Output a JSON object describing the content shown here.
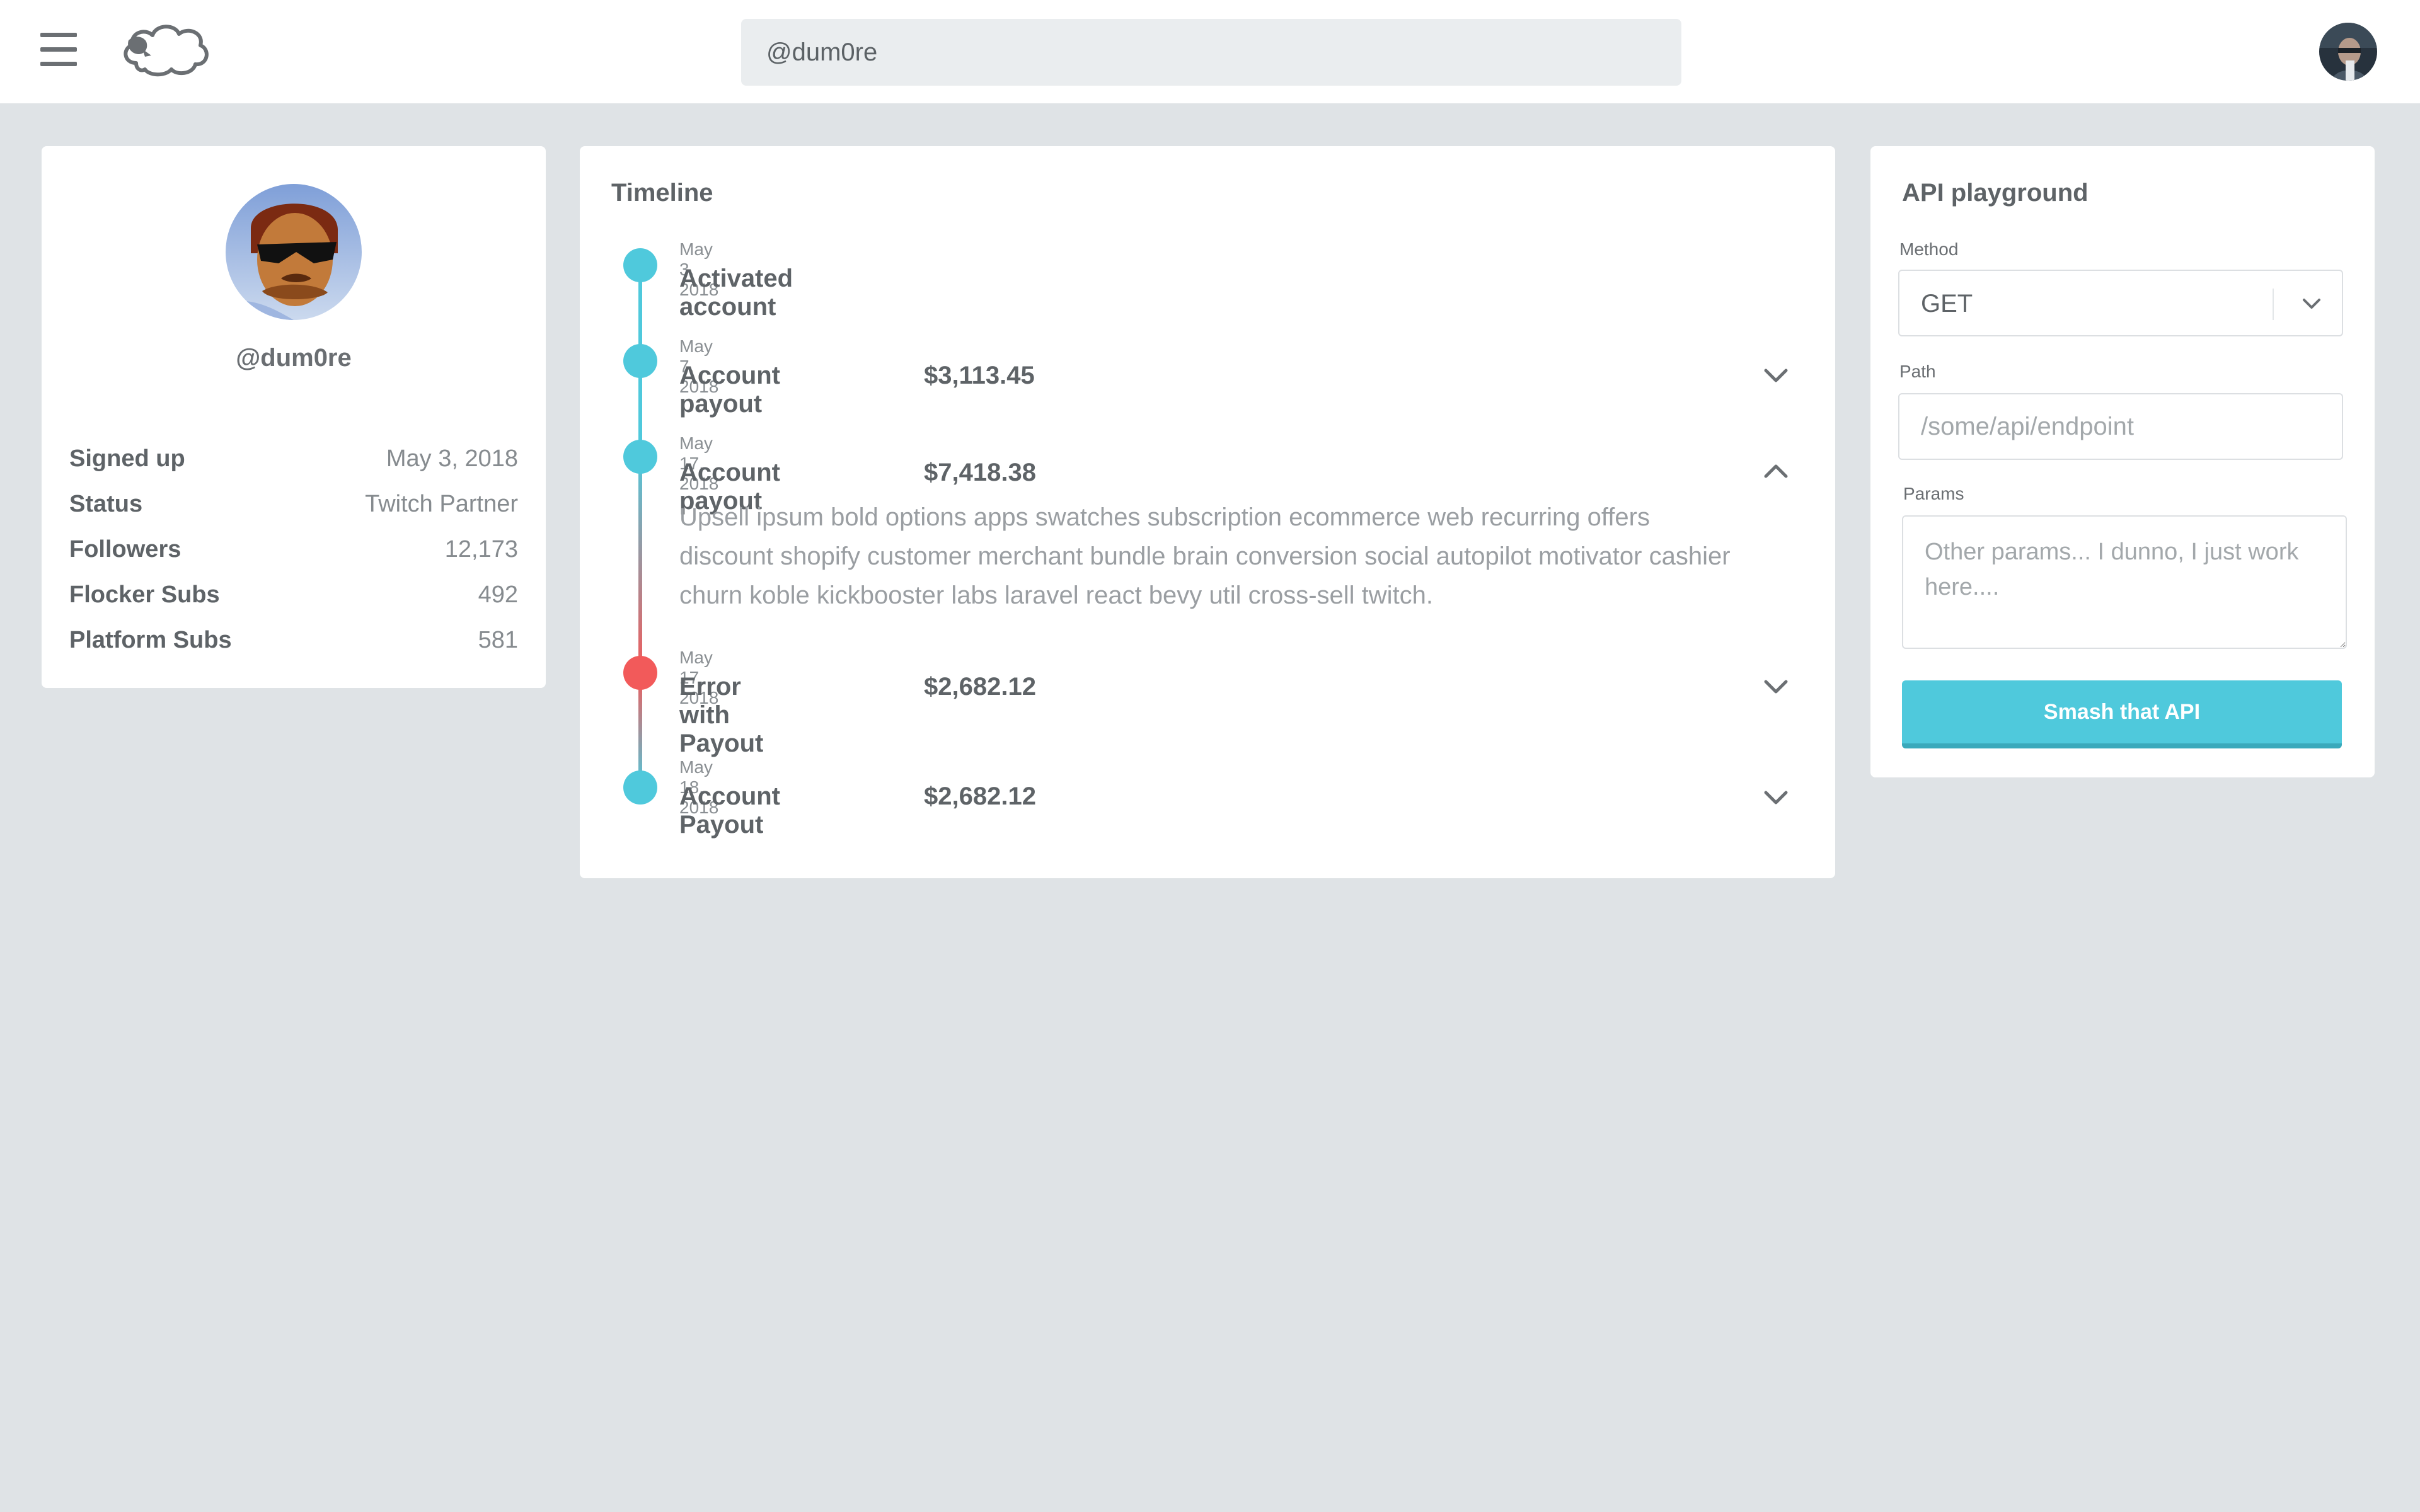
{
  "colors": {
    "background": "#dfe3e6",
    "accent": "#4fc9dc",
    "error": "#f25a5a",
    "text": "#5e6367",
    "muted": "#868b8f"
  },
  "header": {
    "menu_icon": "hamburger-menu-icon",
    "logo_icon": "sheep-logo-icon",
    "search_value": "@dum0re",
    "user_avatar": "user-avatar"
  },
  "profile": {
    "avatar": "cartoon-avatar-sunglasses",
    "handle": "@dum0re",
    "stats": [
      {
        "label": "Signed up",
        "value": "May 3, 2018"
      },
      {
        "label": "Status",
        "value": "Twitch Partner"
      },
      {
        "label": "Followers",
        "value": "12,173"
      },
      {
        "label": "Flocker Subs",
        "value": "492"
      },
      {
        "label": "Platform Subs",
        "value": "581"
      }
    ]
  },
  "timeline": {
    "title": "Timeline",
    "events": [
      {
        "date": "May 3, 2018",
        "title": "Activated account",
        "amount": "",
        "status": "ok",
        "expandable": false,
        "expanded": false
      },
      {
        "date": "May 7, 2018",
        "title": "Account payout",
        "amount": "$3,113.45",
        "status": "ok",
        "expandable": true,
        "expanded": false
      },
      {
        "date": "May 17, 2018",
        "title": "Account payout",
        "amount": "$7,418.38",
        "status": "ok",
        "expandable": true,
        "expanded": true,
        "description": "Upsell ipsum bold options apps swatches subscription ecommerce web recurring offers discount shopify customer merchant bundle brain conversion social autopilot motivator cashier churn koble kickbooster labs laravel react bevy util cross-sell twitch."
      },
      {
        "date": "May 17, 2018",
        "title": "Error with Payout",
        "amount": "$2,682.12",
        "status": "error",
        "expandable": true,
        "expanded": false
      },
      {
        "date": "May 18, 2018",
        "title": "Account Payout",
        "amount": "$2,682.12",
        "status": "ok",
        "expandable": true,
        "expanded": false
      }
    ]
  },
  "api": {
    "title": "API playground",
    "method_label": "Method",
    "method_value": "GET",
    "path_label": "Path",
    "path_placeholder": "/some/api/endpoint",
    "params_label": "Params",
    "params_placeholder": "Other params... I dunno, I just work here....",
    "submit_label": "Smash that API"
  }
}
